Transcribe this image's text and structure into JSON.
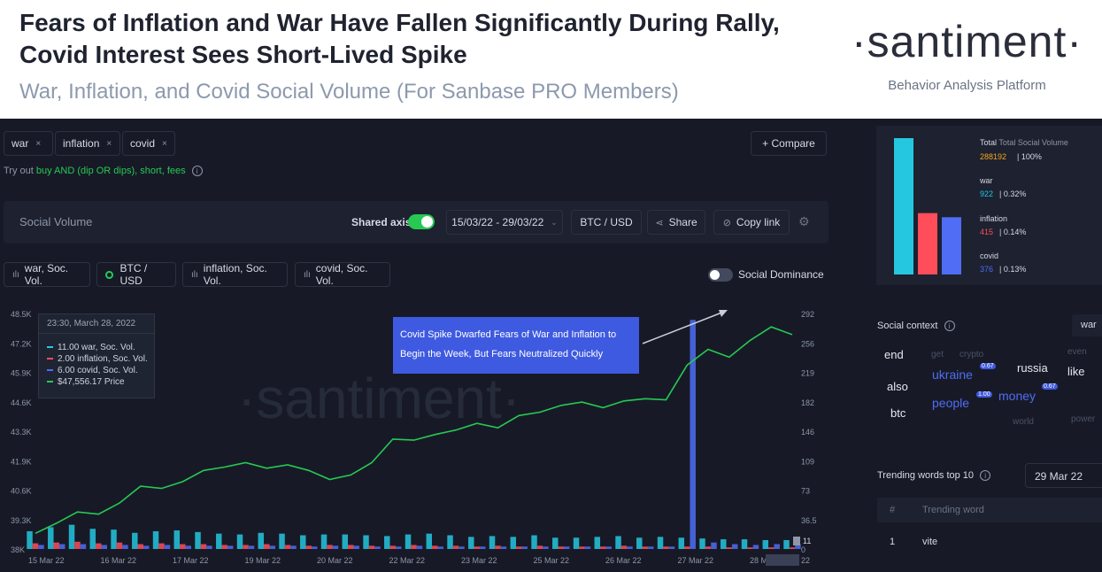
{
  "header": {
    "title": "Fears of Inflation and War Have Fallen Significantly During Rally, Covid Interest Sees Short-Lived Spike",
    "subtitle": "War, Inflation, and Covid Social Volume (For Sanbase PRO Members)",
    "brand": "·santiment·",
    "brand_tagline": "Behavior Analysis Platform"
  },
  "search": {
    "chips": [
      {
        "label": "war",
        "remove": "×"
      },
      {
        "label": "inflation",
        "remove": "×"
      },
      {
        "label": "covid",
        "remove": "×"
      }
    ],
    "compare_label": "+ Compare",
    "hint_prefix": "Try out",
    "hint_example": "buy AND (dip OR dips), short, fees"
  },
  "toolbar": {
    "title": "Social Volume",
    "shared_axis_label": "Shared axis",
    "shared_axis_on": true,
    "date_range": "15/03/22 - 29/03/22",
    "pair": "BTC / USD",
    "share": "Share",
    "copy_link": "Copy link"
  },
  "metrics_legend": {
    "items": [
      "war, Soc. Vol.",
      "BTC / USD",
      "inflation, Soc. Vol.",
      "covid, Soc. Vol."
    ],
    "social_dominance_label": "Social Dominance",
    "social_dominance_on": false
  },
  "tooltip": {
    "time": "23:30, March 28, 2022",
    "rows": [
      {
        "text": "11.00 war, Soc. Vol.",
        "color": "#25c7e0"
      },
      {
        "text": "2.00 inflation, Soc. Vol.",
        "color": "#ff4d5a"
      },
      {
        "text": "6.00 covid, Soc. Vol.",
        "color": "#4f6df5"
      },
      {
        "text": "$47,556.17 Price",
        "color": "#26c953"
      }
    ]
  },
  "annotation": {
    "text": "Covid Spike Dwarfed Fears of War and Inflation to Begin the Week, But Fears Neutralized Quickly"
  },
  "colors": {
    "war": "#25c7e0",
    "inflation": "#ff4d5a",
    "covid": "#4f6df5",
    "price": "#26c953",
    "background": "#171a26"
  },
  "chart_data": {
    "type": "line",
    "watermark": "·santiment·",
    "x_labels": [
      "15 Mar 22",
      "16 Mar 22",
      "17 Mar 22",
      "19 Mar 22",
      "20 Mar 22",
      "22 Mar 22",
      "23 Mar 22",
      "25 Mar 22",
      "26 Mar 22",
      "27 Mar 22",
      "28 Mar 22"
    ],
    "y_left_ticks": [
      "48.5K",
      "47.2K",
      "45.9K",
      "44.6K",
      "43.3K",
      "41.9K",
      "40.6K",
      "39.3K",
      "38K"
    ],
    "y_right_ticks": [
      "292",
      "256",
      "219",
      "182",
      "146",
      "109",
      "73",
      "36.5",
      "0"
    ],
    "y_left_range": [
      38000,
      48500
    ],
    "y_right_range": [
      0,
      292
    ],
    "price_badge": "11",
    "price_badge_right": "22",
    "series": [
      {
        "name": "BTC / USD",
        "axis": "left",
        "values": [
          38700,
          39150,
          39650,
          39550,
          40050,
          40800,
          40700,
          41000,
          41500,
          41650,
          41850,
          41600,
          41750,
          41500,
          41100,
          41300,
          41850,
          42900,
          42850,
          43100,
          43300,
          43600,
          43400,
          43950,
          44100,
          44400,
          44550,
          44300,
          44600,
          44700,
          44650,
          46200,
          46900,
          46550,
          47300,
          47900,
          47556
        ]
      },
      {
        "name": "war, Soc. Vol.",
        "axis": "right",
        "values": [
          22,
          27,
          30,
          25,
          24,
          20,
          22,
          23,
          21,
          19,
          18,
          20,
          19,
          17,
          18,
          18,
          17,
          16,
          18,
          19,
          17,
          15,
          16,
          15,
          17,
          14,
          14,
          15,
          16,
          14,
          15,
          14,
          13,
          12,
          12,
          11,
          11
        ]
      },
      {
        "name": "inflation, Soc. Vol.",
        "axis": "right",
        "values": [
          7,
          8,
          9,
          7,
          8,
          6,
          7,
          6,
          6,
          5,
          5,
          6,
          5,
          4,
          5,
          5,
          4,
          4,
          5,
          4,
          4,
          3,
          4,
          3,
          4,
          3,
          3,
          3,
          4,
          3,
          3,
          3,
          3,
          2,
          2,
          2,
          2
        ]
      },
      {
        "name": "covid, Soc. Vol.",
        "axis": "right",
        "values": [
          5,
          6,
          6,
          5,
          5,
          4,
          5,
          4,
          4,
          4,
          4,
          4,
          4,
          3,
          4,
          4,
          3,
          3,
          4,
          3,
          3,
          3,
          3,
          3,
          3,
          3,
          3,
          3,
          3,
          3,
          3,
          284,
          8,
          6,
          5,
          6,
          6
        ]
      }
    ]
  },
  "totals": {
    "total_label": "Total Social Volume",
    "total_value": "288192",
    "total_pct": "100%",
    "items": [
      {
        "name": "war",
        "value": "922",
        "pct": "0.32%",
        "color": "#25c7e0"
      },
      {
        "name": "inflation",
        "value": "415",
        "pct": "0.14%",
        "color": "#ff4d5a"
      },
      {
        "name": "covid",
        "value": "376",
        "pct": "0.13%",
        "color": "#4f6df5"
      }
    ],
    "bar_heights": [
      1.0,
      0.45,
      0.42
    ]
  },
  "social_context": {
    "title": "Social context",
    "selected": "war",
    "words": [
      {
        "text": "end",
        "size": 13,
        "color": "#e6e9f0"
      },
      {
        "text": "get",
        "size": 10,
        "color": "#4a5166"
      },
      {
        "text": "crypto",
        "size": 10,
        "color": "#4a5166"
      },
      {
        "text": "even",
        "size": 10,
        "color": "#4a5166"
      },
      {
        "text": "ukraine",
        "size": 14,
        "color": "#4f6df5"
      },
      {
        "text": "0.67",
        "size": 7,
        "color": "#ffffff"
      },
      {
        "text": "russia",
        "size": 13,
        "color": "#e6e9f0"
      },
      {
        "text": "like",
        "size": 13,
        "color": "#e6e9f0"
      },
      {
        "text": "also",
        "size": 13,
        "color": "#e6e9f0"
      },
      {
        "text": "money",
        "size": 14,
        "color": "#4f6df5"
      },
      {
        "text": "0.67",
        "size": 7,
        "color": "#ffffff"
      },
      {
        "text": "people",
        "size": 14,
        "color": "#4f6df5"
      },
      {
        "text": "1.00",
        "size": 7,
        "color": "#ffffff"
      },
      {
        "text": "btc",
        "size": 13,
        "color": "#e6e9f0"
      },
      {
        "text": "world",
        "size": 10,
        "color": "#4a5166"
      },
      {
        "text": "power",
        "size": 10,
        "color": "#4a5166"
      }
    ]
  },
  "trending": {
    "title": "Trending words top 10",
    "date": "29 Mar 22",
    "col_rank": "#",
    "col_word": "Trending word",
    "rows": [
      {
        "rank": "1",
        "word": "vite"
      }
    ]
  }
}
